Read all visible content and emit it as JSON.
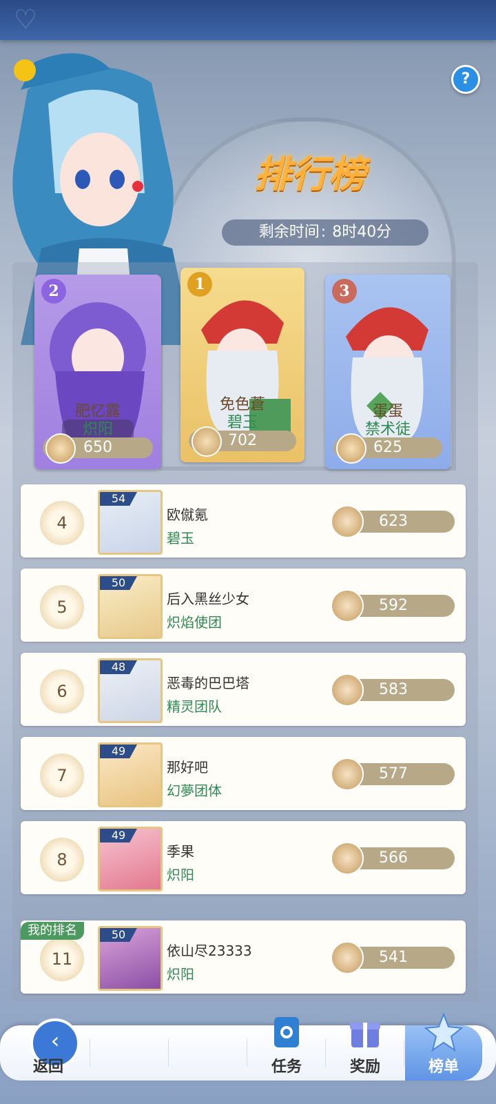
{
  "header": {
    "help_label": "?"
  },
  "title": "排行榜",
  "timer": {
    "label": "剩余时间",
    "separator": ":",
    "value": "8时40分"
  },
  "podium": [
    {
      "rank": "2",
      "name": "肥忆露",
      "guild": "炽阳",
      "score": "650"
    },
    {
      "rank": "1",
      "name": "免色蒼",
      "guild": "碧玉",
      "score": "702"
    },
    {
      "rank": "3",
      "name": "蛋蛋",
      "guild": "禁术徒",
      "score": "625"
    }
  ],
  "rows": [
    {
      "rank": "4",
      "level": "54",
      "name": "欧僦氪",
      "guild": "碧玉",
      "score": "623"
    },
    {
      "rank": "5",
      "level": "50",
      "name": "后入黑丝少女",
      "guild": "炽焰使团",
      "score": "592"
    },
    {
      "rank": "6",
      "level": "48",
      "name": "恶毒的巴巴塔",
      "guild": "精灵团队",
      "score": "583"
    },
    {
      "rank": "7",
      "level": "49",
      "name": "那好吧",
      "guild": "幻夢团体",
      "score": "577"
    },
    {
      "rank": "8",
      "level": "49",
      "name": "季果",
      "guild": "炽阳",
      "score": "566"
    }
  ],
  "my_rank": {
    "tag": "我的排名",
    "rank": "11",
    "level": "50",
    "name": "依山尽23333",
    "guild": "炽阳",
    "score": "541"
  },
  "nav": {
    "back": "返回",
    "tasks": "任务",
    "rewards": "奖励",
    "ranking": "榜单"
  },
  "colors": {
    "guild_green": "#2e8a53",
    "score_bar": "#b7a888",
    "title_orange": "#ffb13a",
    "nav_active": "#5f94e5"
  }
}
